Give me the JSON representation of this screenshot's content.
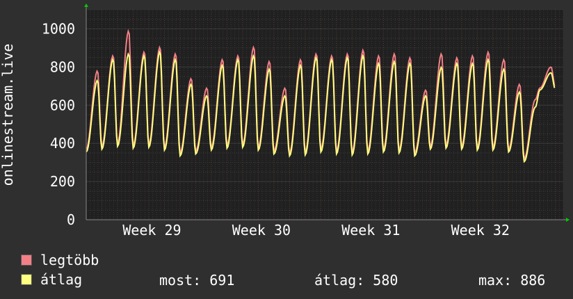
{
  "chart_data": {
    "type": "line",
    "ylabel": "onlinestream.live",
    "ylim": [
      0,
      1100
    ],
    "yticks": [
      0,
      200,
      400,
      600,
      800,
      1000
    ],
    "xlim_days": [
      0,
      30.5
    ],
    "x_week_labels": [
      {
        "label": "Week 29",
        "day": 4.2
      },
      {
        "label": "Week 30",
        "day": 11.2
      },
      {
        "label": "Week 31",
        "day": 18.2
      },
      {
        "label": "Week 32",
        "day": 25.2
      }
    ],
    "grid": true,
    "colors": {
      "background": "#2f2f2f",
      "plot_bg": "#202020",
      "max_line": "#f57f86",
      "avg_line": "#ffff80",
      "grid": "#555555",
      "arrow": "#00cc00"
    },
    "series": [
      {
        "name": "legtöbb",
        "daily_peaks": [
          780,
          860,
          990,
          880,
          905,
          870,
          740,
          690,
          840,
          860,
          905,
          830,
          690,
          840,
          870,
          860,
          870,
          890,
          860,
          870,
          850,
          680,
          870,
          850,
          860,
          880,
          840,
          710,
          630,
          800
        ],
        "daily_troughs": [
          370,
          385,
          400,
          390,
          395,
          380,
          350,
          360,
          380,
          390,
          395,
          380,
          360,
          350,
          355,
          370,
          360,
          355,
          360,
          370,
          365,
          350,
          385,
          390,
          385,
          380,
          380,
          370,
          320,
          690
        ]
      },
      {
        "name": "átlag",
        "daily_peaks": [
          730,
          840,
          870,
          860,
          880,
          840,
          710,
          650,
          810,
          840,
          860,
          790,
          650,
          810,
          850,
          840,
          850,
          860,
          820,
          830,
          820,
          650,
          800,
          820,
          820,
          840,
          790,
          670,
          590,
          770
        ],
        "daily_troughs": [
          355,
          370,
          385,
          375,
          380,
          365,
          335,
          345,
          365,
          375,
          380,
          365,
          345,
          335,
          340,
          355,
          345,
          340,
          345,
          355,
          350,
          335,
          370,
          375,
          370,
          365,
          365,
          355,
          305,
          680
        ]
      }
    ]
  },
  "legend": {
    "max_label": "legtöbb",
    "avg_label": "átlag"
  },
  "stats": {
    "now": "most: 691",
    "avg": "átlag: 580",
    "max": "max: 886"
  }
}
